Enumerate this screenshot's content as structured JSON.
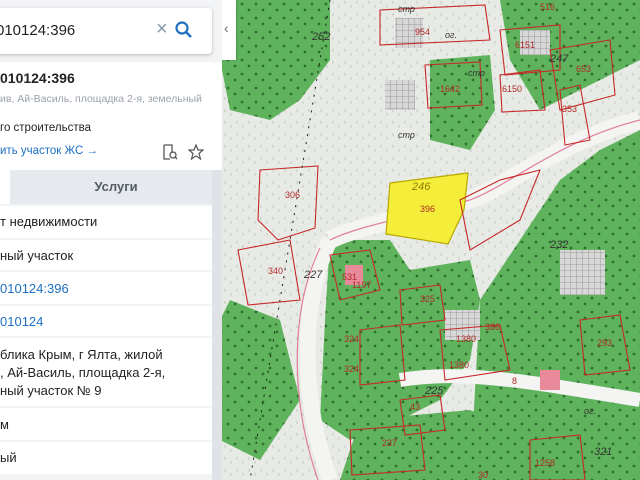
{
  "search": {
    "value": "010124:396"
  },
  "parcel": {
    "title": "010124:396",
    "address": "ив, Ай-Василь, площадка 2-я, земельный",
    "purpose": "го строительства",
    "link": "ить участок ЖС →"
  },
  "tabs": {
    "services": "Услуги"
  },
  "rows": [
    "т недвижимости",
    "ный участок",
    "010124:396",
    "010124",
    "блика Крым, г Ялта, жилой",
    ", Ай-Василь, площадка 2-я,",
    "ный участок № 9",
    "м",
    "ый"
  ],
  "map": {
    "labels": [
      "396",
      "246",
      "252",
      "954",
      "516",
      "6151",
      "653",
      "6150",
      "1642",
      "353",
      "247",
      "306",
      "232",
      "340",
      "227",
      "531",
      "1197",
      "325",
      "386",
      "293",
      "1380",
      "324",
      "324",
      "225",
      "1380",
      "43",
      "8",
      "237",
      "1258",
      "30",
      "321"
    ],
    "strings": [
      "стр",
      "стр",
      "стр",
      "ог.",
      "ог."
    ]
  }
}
